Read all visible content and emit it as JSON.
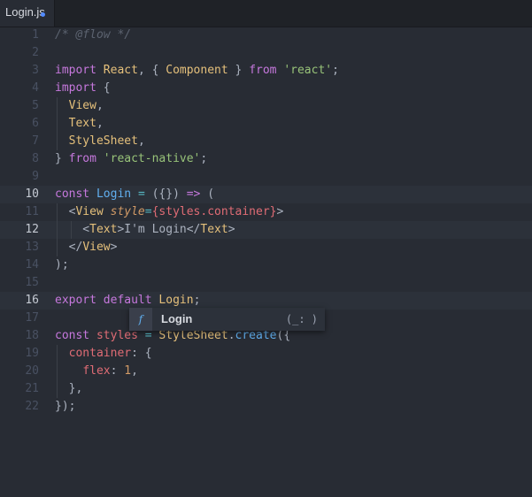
{
  "tab": {
    "filename": "Login.js"
  },
  "editor": {
    "lines": [
      {
        "num": "1",
        "active": false,
        "tokens": [
          [
            "comment",
            "/* @flow */"
          ]
        ]
      },
      {
        "num": "2",
        "active": false,
        "tokens": []
      },
      {
        "num": "3",
        "active": false,
        "tokens": [
          [
            "kw",
            "import"
          ],
          [
            "plain",
            " "
          ],
          [
            "type",
            "React"
          ],
          [
            "plain",
            ", { "
          ],
          [
            "type",
            "Component"
          ],
          [
            "plain",
            " } "
          ],
          [
            "kw",
            "from"
          ],
          [
            "plain",
            " "
          ],
          [
            "str",
            "'react'"
          ],
          [
            "plain",
            ";"
          ]
        ]
      },
      {
        "num": "4",
        "active": false,
        "tokens": [
          [
            "kw",
            "import"
          ],
          [
            "plain",
            " {"
          ]
        ]
      },
      {
        "num": "5",
        "active": false,
        "tokens": [
          [
            "plain",
            "  "
          ],
          [
            "type",
            "View"
          ],
          [
            "plain",
            ","
          ]
        ]
      },
      {
        "num": "6",
        "active": false,
        "tokens": [
          [
            "plain",
            "  "
          ],
          [
            "type",
            "Text"
          ],
          [
            "plain",
            ","
          ]
        ]
      },
      {
        "num": "7",
        "active": false,
        "tokens": [
          [
            "plain",
            "  "
          ],
          [
            "type",
            "StyleSheet"
          ],
          [
            "plain",
            ","
          ]
        ]
      },
      {
        "num": "8",
        "active": false,
        "tokens": [
          [
            "plain",
            "} "
          ],
          [
            "kw",
            "from"
          ],
          [
            "plain",
            " "
          ],
          [
            "str",
            "'react-native'"
          ],
          [
            "plain",
            ";"
          ]
        ]
      },
      {
        "num": "9",
        "active": false,
        "tokens": []
      },
      {
        "num": "10",
        "active": true,
        "tokens": [
          [
            "kw",
            "const"
          ],
          [
            "plain",
            " "
          ],
          [
            "fn",
            "Login"
          ],
          [
            "plain",
            " "
          ],
          [
            "op",
            "="
          ],
          [
            "plain",
            " ({}) "
          ],
          [
            "kw",
            "=>"
          ],
          [
            "plain",
            " ("
          ]
        ]
      },
      {
        "num": "11",
        "active": false,
        "tokens": [
          [
            "plain",
            "  <"
          ],
          [
            "type",
            "View"
          ],
          [
            "plain",
            " "
          ],
          [
            "attr",
            "style"
          ],
          [
            "op",
            "="
          ],
          [
            "prop",
            "{styles.container}"
          ],
          [
            "plain",
            ">"
          ]
        ]
      },
      {
        "num": "12",
        "active": true,
        "tokens": [
          [
            "plain",
            "    <"
          ],
          [
            "type",
            "Text"
          ],
          [
            "plain",
            ">I'm Login</"
          ],
          [
            "type",
            "Text"
          ],
          [
            "plain",
            ">"
          ]
        ]
      },
      {
        "num": "13",
        "active": false,
        "tokens": [
          [
            "plain",
            "  </"
          ],
          [
            "type",
            "View"
          ],
          [
            "plain",
            ">"
          ]
        ]
      },
      {
        "num": "14",
        "active": false,
        "tokens": [
          [
            "plain",
            ");"
          ]
        ]
      },
      {
        "num": "15",
        "active": false,
        "tokens": []
      },
      {
        "num": "16",
        "active": true,
        "tokens": [
          [
            "kw",
            "export"
          ],
          [
            "plain",
            " "
          ],
          [
            "kw",
            "default"
          ],
          [
            "plain",
            " "
          ],
          [
            "type",
            "Login"
          ],
          [
            "plain",
            ";"
          ]
        ]
      },
      {
        "num": "17",
        "active": false,
        "tokens": []
      },
      {
        "num": "18",
        "active": false,
        "tokens": [
          [
            "kw",
            "const"
          ],
          [
            "plain",
            " "
          ],
          [
            "prop",
            "styles"
          ],
          [
            "plain",
            " "
          ],
          [
            "op",
            "="
          ],
          [
            "plain",
            " "
          ],
          [
            "type",
            "StyleSheet"
          ],
          [
            "plain",
            "."
          ],
          [
            "fn",
            "create"
          ],
          [
            "plain",
            "({"
          ]
        ]
      },
      {
        "num": "19",
        "active": false,
        "tokens": [
          [
            "plain",
            "  "
          ],
          [
            "prop",
            "container"
          ],
          [
            "plain",
            ": {"
          ]
        ]
      },
      {
        "num": "20",
        "active": false,
        "tokens": [
          [
            "plain",
            "    "
          ],
          [
            "prop",
            "flex"
          ],
          [
            "plain",
            ": "
          ],
          [
            "num",
            "1"
          ],
          [
            "plain",
            ","
          ]
        ]
      },
      {
        "num": "21",
        "active": false,
        "tokens": [
          [
            "plain",
            "  },"
          ]
        ]
      },
      {
        "num": "22",
        "active": false,
        "tokens": [
          [
            "plain",
            "});"
          ]
        ]
      }
    ]
  },
  "autocomplete": {
    "type_icon": "f",
    "suggestion": "Login",
    "signature": "(_: )",
    "icon_name": "function-icon",
    "accent": "#61afef"
  }
}
